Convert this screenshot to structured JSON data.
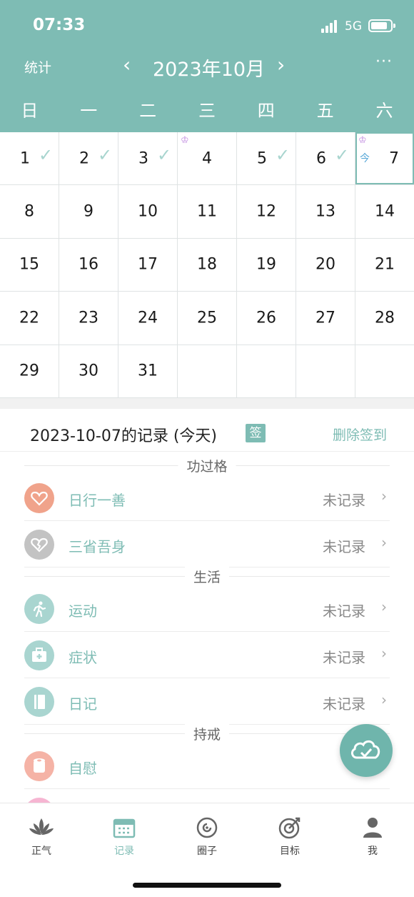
{
  "status_bar": {
    "time": "07:33",
    "network": "5G"
  },
  "header": {
    "stats_label": "统计",
    "prev_icon": "‹",
    "month": "2023年10月",
    "next_icon": "›",
    "more_icon": "···"
  },
  "weekdays": [
    "日",
    "一",
    "二",
    "三",
    "四",
    "五",
    "六"
  ],
  "calendar": {
    "days": [
      {
        "d": "1",
        "check": true
      },
      {
        "d": "2",
        "check": true
      },
      {
        "d": "3",
        "check": true
      },
      {
        "d": "4",
        "trophy": true
      },
      {
        "d": "5",
        "check": true
      },
      {
        "d": "6",
        "check": true
      },
      {
        "d": "7",
        "trophy": true,
        "today": true
      },
      {
        "d": "8"
      },
      {
        "d": "9"
      },
      {
        "d": "10"
      },
      {
        "d": "11"
      },
      {
        "d": "12"
      },
      {
        "d": "13"
      },
      {
        "d": "14"
      },
      {
        "d": "15"
      },
      {
        "d": "16"
      },
      {
        "d": "17"
      },
      {
        "d": "18"
      },
      {
        "d": "19"
      },
      {
        "d": "20"
      },
      {
        "d": "21"
      },
      {
        "d": "22"
      },
      {
        "d": "23"
      },
      {
        "d": "24"
      },
      {
        "d": "25"
      },
      {
        "d": "26"
      },
      {
        "d": "27"
      },
      {
        "d": "28"
      },
      {
        "d": "29"
      },
      {
        "d": "30"
      },
      {
        "d": "31"
      },
      {
        "d": ""
      },
      {
        "d": ""
      },
      {
        "d": ""
      },
      {
        "d": ""
      }
    ],
    "today_tag": "今",
    "check_glyph": "✓",
    "trophy_glyph": "♔"
  },
  "record": {
    "title": "2023-10-07的记录 (今天)",
    "sign_badge": "签",
    "delete_label": "删除签到"
  },
  "sections": [
    {
      "title": "功过格"
    },
    {
      "title": "生活"
    },
    {
      "title": "持戒"
    }
  ],
  "items": [
    {
      "label": "日行一善",
      "status": "未记录",
      "icon": "heart-icon",
      "color": "#f0a38b"
    },
    {
      "label": "三省吾身",
      "status": "未记录",
      "icon": "broken-heart-icon",
      "color": "#c3c3c3"
    },
    {
      "label": "运动",
      "status": "未记录",
      "icon": "running-icon",
      "color": "#a9d5d0"
    },
    {
      "label": "症状",
      "status": "未记录",
      "icon": "medkit-icon",
      "color": "#a9d5d0"
    },
    {
      "label": "日记",
      "status": "未记录",
      "icon": "book-icon",
      "color": "#a9d5d0"
    },
    {
      "label": "自慰",
      "status": "",
      "icon": "tissue-icon",
      "color": "#f5b3a6"
    }
  ],
  "tabs": [
    {
      "label": "正气",
      "icon": "lotus-icon",
      "active": false
    },
    {
      "label": "记录",
      "icon": "calendar-icon",
      "active": true
    },
    {
      "label": "圈子",
      "icon": "circle-icon",
      "active": false
    },
    {
      "label": "目标",
      "icon": "target-icon",
      "active": false
    },
    {
      "label": "我",
      "icon": "user-icon",
      "active": false
    }
  ],
  "colors": {
    "accent": "#7ebcb4",
    "divider": "#dfe3e4"
  }
}
